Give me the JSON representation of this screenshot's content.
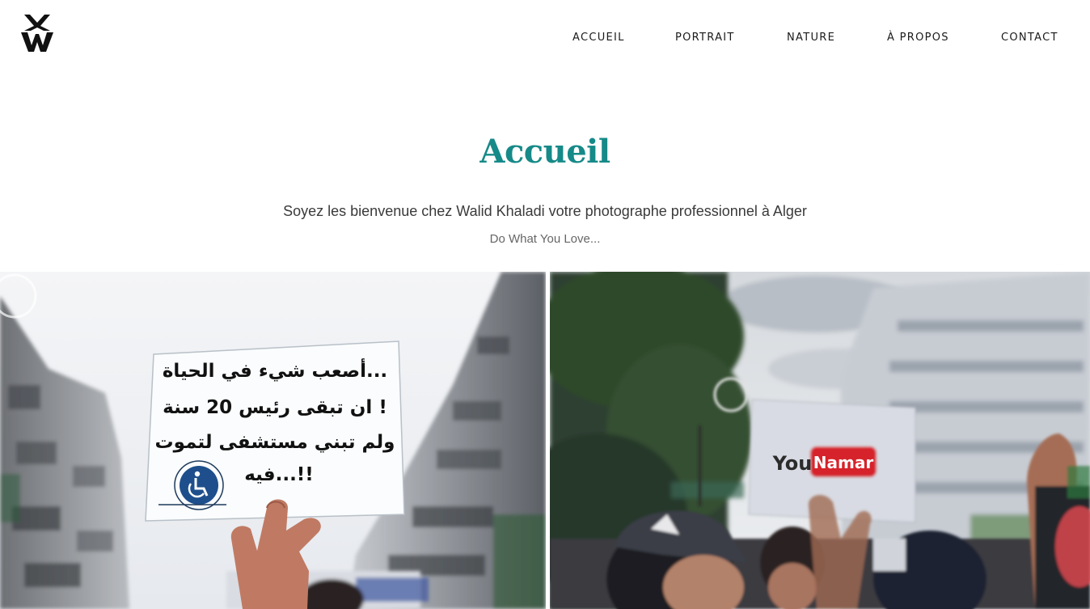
{
  "header": {
    "logo_alt": "WK",
    "nav": [
      {
        "label": "ACCUEIL"
      },
      {
        "label": "PORTRAIT"
      },
      {
        "label": "NATURE"
      },
      {
        "label": "À PROPOS"
      },
      {
        "label": "CONTACT"
      }
    ]
  },
  "hero": {
    "title": "Accueil",
    "subtitle": "Soyez les bienvenue chez Walid Khaladi votre photographe professionnel à Alger",
    "tagline": "Do What You Love..."
  },
  "gallery": {
    "photo1": {
      "sign_lines": [
        "أصعب شيء في الحياة...",
        "ان تبقى رئيس 20 سنة !",
        "ولم تبني مستشفى لتموت",
        "فيه...!!"
      ]
    },
    "photo2": {
      "sign_you": "You",
      "sign_brand": "Namar"
    }
  },
  "colors": {
    "accent": "#168a88",
    "text": "#1a1a1a",
    "youtube_red": "#d6222a"
  }
}
